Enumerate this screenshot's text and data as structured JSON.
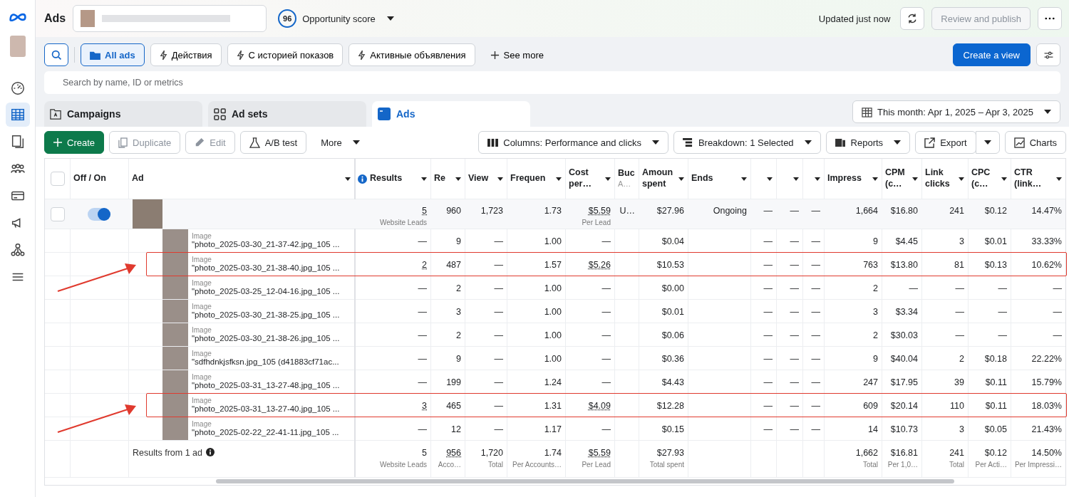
{
  "sidebar": {
    "items": [
      {
        "selected": false
      },
      {
        "selected": true
      },
      {
        "selected": false
      },
      {
        "selected": false
      },
      {
        "selected": false
      },
      {
        "selected": false
      },
      {
        "selected": false
      },
      {
        "selected": false
      }
    ]
  },
  "header": {
    "title": "Ads",
    "score": "96",
    "score_label": "Opportunity score",
    "updated": "Updated just now",
    "publish": {
      "label": "Review and publish",
      "disabled": true
    }
  },
  "filters": {
    "chips": [
      {
        "label": "All ads",
        "kind": "folder",
        "selected": true
      },
      {
        "label": "Действия",
        "kind": "flash",
        "selected": false
      },
      {
        "label": "С историей показов",
        "kind": "flash",
        "selected": false
      },
      {
        "label": "Активные объявления",
        "kind": "flash",
        "selected": false
      },
      {
        "label": "See more",
        "kind": "add",
        "selected": false
      }
    ],
    "create_view": "Create a view"
  },
  "search": {
    "placeholder": "Search by name, ID or metrics"
  },
  "tabs": [
    {
      "label": "Campaigns",
      "selected": false
    },
    {
      "label": "Ad sets",
      "selected": false
    },
    {
      "label": "Ads",
      "selected": true
    }
  ],
  "date_range": "This month: Apr 1, 2025 – Apr 3, 2025",
  "toolbar": {
    "left": [
      {
        "label": "Create",
        "kind": "create",
        "disabled": false
      },
      {
        "label": "Duplicate",
        "kind": "duplicate",
        "disabled": true
      },
      {
        "label": "Edit",
        "kind": "edit",
        "disabled": true
      },
      {
        "label": "A/B test",
        "kind": "test",
        "disabled": false
      },
      {
        "label": "More",
        "kind": "more",
        "disabled": false
      }
    ],
    "right": [
      {
        "label": "Columns: Performance and clicks",
        "kind": "columns"
      },
      {
        "label": "Breakdown: 1 Selected",
        "kind": "breakdown"
      },
      {
        "label": "Reports",
        "kind": "reports"
      },
      {
        "label": "Export",
        "kind": "export"
      },
      {
        "label": "Charts",
        "kind": "charts"
      }
    ]
  },
  "table": {
    "select_all": {
      "checked": false
    },
    "fixed_columns": [
      {
        "label": "Off / On",
        "sortable": false
      },
      {
        "label": "Ad",
        "sortable": true
      }
    ],
    "columns": [
      {
        "label": "Results",
        "sortable": true,
        "info": true
      },
      {
        "label": "Re",
        "sortable": true
      },
      {
        "label": "View",
        "sortable": true
      },
      {
        "label": "Frequen",
        "sortable": true
      },
      {
        "label": "Cost per…",
        "sortable": true
      },
      {
        "label": "Buc",
        "sub": "A…",
        "sortable": false
      },
      {
        "label": "Amoun spent",
        "sortable": true
      },
      {
        "label": "Ends",
        "sortable": true
      },
      {
        "sortable": true
      },
      {
        "sortable": true
      },
      {
        "sortable": true
      },
      {
        "label": "Impress",
        "sortable": true
      },
      {
        "label": "CPM (c…",
        "sortable": true
      },
      {
        "label": "Link clicks",
        "sortable": true
      },
      {
        "label": "CPC (c…",
        "sortable": true
      },
      {
        "label": "CTR (link…",
        "sortable": true
      }
    ],
    "ad_row": {
      "checked": false,
      "on": true,
      "cells": [
        {
          "text": "5",
          "sub": "Website Leads",
          "underlined": true
        },
        "960",
        "1,723",
        "1.73",
        {
          "text": "$5.59",
          "sub": "Per Lead",
          "underlined": true
        },
        "U…",
        "$27.96",
        "Ongoing",
        "—",
        "—",
        "—",
        "1,664",
        "$16.80",
        "241",
        "$0.12",
        "14.47%"
      ]
    },
    "rows": [
      {
        "label": "Image",
        "name": "\"photo_2025-03-30_21-37-42.jpg_105 ...",
        "highlighted": false,
        "cells": [
          "—",
          "9",
          "—",
          "1.00",
          "—",
          null,
          "$0.04",
          null,
          "—",
          "—",
          "—",
          "9",
          "$4.45",
          "3",
          "$0.01",
          "33.33%"
        ]
      },
      {
        "label": "Image",
        "name": "\"photo_2025-03-30_21-38-40.jpg_105 ...",
        "highlighted": true,
        "cells": [
          {
            "text": "2",
            "underlined": true
          },
          "487",
          "—",
          "1.57",
          {
            "text": "$5.26",
            "underlined": true
          },
          null,
          "$10.53",
          null,
          "—",
          "—",
          "—",
          "763",
          "$13.80",
          "81",
          "$0.13",
          "10.62%"
        ]
      },
      {
        "label": "Image",
        "name": "\"photo_2025-03-25_12-04-16.jpg_105 ...",
        "highlighted": false,
        "cells": [
          "—",
          "2",
          "—",
          "1.00",
          "—",
          null,
          "$0.00",
          null,
          "—",
          "—",
          "—",
          "2",
          "—",
          "—",
          "—",
          "—"
        ]
      },
      {
        "label": "Image",
        "name": "\"photo_2025-03-30_21-38-25.jpg_105 ...",
        "highlighted": false,
        "cells": [
          "—",
          "3",
          "—",
          "1.00",
          "—",
          null,
          "$0.01",
          null,
          "—",
          "—",
          "—",
          "3",
          "$3.34",
          "—",
          "—",
          "—"
        ]
      },
      {
        "label": "Image",
        "name": "\"photo_2025-03-30_21-38-26.jpg_105 ...",
        "highlighted": false,
        "cells": [
          "—",
          "2",
          "—",
          "1.00",
          "—",
          null,
          "$0.06",
          null,
          "—",
          "—",
          "—",
          "2",
          "$30.03",
          "—",
          "—",
          "—"
        ]
      },
      {
        "label": "Image",
        "name": "\"sdfhdnkjsfksn.jpg_105 (d41883cf71ac...",
        "highlighted": false,
        "cells": [
          "—",
          "9",
          "—",
          "1.00",
          "—",
          null,
          "$0.36",
          null,
          "—",
          "—",
          "—",
          "9",
          "$40.04",
          "2",
          "$0.18",
          "22.22%"
        ]
      },
      {
        "label": "Image",
        "name": "\"photo_2025-03-31_13-27-48.jpg_105 ...",
        "highlighted": false,
        "cells": [
          "—",
          "199",
          "—",
          "1.24",
          "—",
          null,
          "$4.43",
          null,
          "—",
          "—",
          "—",
          "247",
          "$17.95",
          "39",
          "$0.11",
          "15.79%"
        ]
      },
      {
        "label": "Image",
        "name": "\"photo_2025-03-31_13-27-40.jpg_105 ...",
        "highlighted": true,
        "cells": [
          {
            "text": "3",
            "underlined": true
          },
          "465",
          "—",
          "1.31",
          {
            "text": "$4.09",
            "underlined": true
          },
          null,
          "$12.28",
          null,
          "—",
          "—",
          "—",
          "609",
          "$20.14",
          "110",
          "$0.11",
          "18.03%"
        ]
      },
      {
        "label": "Image",
        "name": "\"photo_2025-02-22_22-41-11.jpg_105 ...",
        "highlighted": false,
        "cells": [
          "—",
          "12",
          "—",
          "1.17",
          "—",
          null,
          "$0.15",
          null,
          "—",
          "—",
          "—",
          "14",
          "$10.73",
          "3",
          "$0.05",
          "21.43%"
        ]
      }
    ],
    "footer": {
      "label": "Results from 1 ad",
      "cells": [
        {
          "text": "5",
          "sub": "Website Leads"
        },
        {
          "text": "956",
          "sub": "Acco…",
          "underlined": true
        },
        {
          "text": "1,720",
          "sub": "Total"
        },
        {
          "text": "1.74",
          "sub": "Per Accounts…"
        },
        {
          "text": "$5.59",
          "sub": "Per Lead",
          "underlined": true
        },
        null,
        {
          "text": "$27.93",
          "sub": "Total spent"
        },
        null,
        null,
        null,
        null,
        {
          "text": "1,662",
          "sub": "Total"
        },
        {
          "text": "$16.81",
          "sub": "Per 1,0…"
        },
        {
          "text": "241",
          "sub": "Total"
        },
        {
          "text": "$0.12",
          "sub": "Per Acti…"
        },
        {
          "text": "14.50%",
          "sub": "Per Impressi…"
        }
      ]
    }
  }
}
